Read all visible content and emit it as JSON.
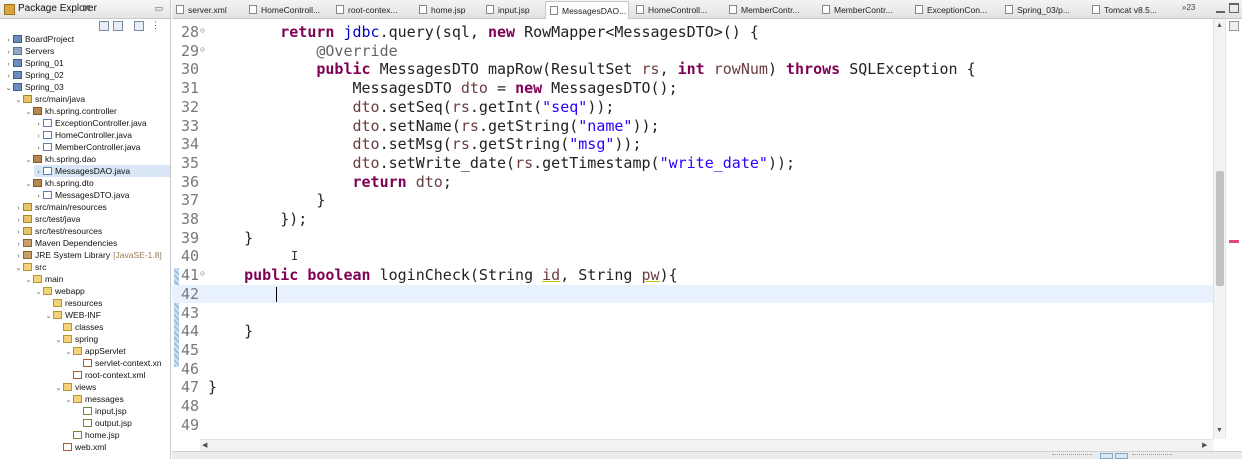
{
  "explorer": {
    "title": "Package Explorer",
    "close": "✕",
    "tree": [
      {
        "label": "BoardProject",
        "icon": "project",
        "twisty": "›",
        "depth": 0
      },
      {
        "label": "Servers",
        "icon": "server",
        "twisty": "›",
        "depth": 0
      },
      {
        "label": "Spring_01",
        "icon": "project",
        "twisty": "›",
        "depth": 0
      },
      {
        "label": "Spring_02",
        "icon": "project",
        "twisty": "›",
        "depth": 0
      },
      {
        "label": "Spring_03",
        "icon": "project",
        "twisty": "⌄",
        "depth": 0
      },
      {
        "label": "src/main/java",
        "icon": "srcfolder",
        "twisty": "⌄",
        "depth": 1
      },
      {
        "label": "kh.spring.controller",
        "icon": "package",
        "twisty": "⌄",
        "depth": 2
      },
      {
        "label": "ExceptionController.java",
        "icon": "java",
        "twisty": "›",
        "depth": 3
      },
      {
        "label": "HomeController.java",
        "icon": "java",
        "twisty": "›",
        "depth": 3
      },
      {
        "label": "MemberController.java",
        "icon": "java",
        "twisty": "›",
        "depth": 3
      },
      {
        "label": "kh.spring.dao",
        "icon": "package",
        "twisty": "⌄",
        "depth": 2
      },
      {
        "label": "MessagesDAO.java",
        "icon": "java",
        "twisty": "›",
        "depth": 3,
        "selected": true
      },
      {
        "label": "kh.spring.dto",
        "icon": "package",
        "twisty": "⌄",
        "depth": 2
      },
      {
        "label": "MessagesDTO.java",
        "icon": "java",
        "twisty": "›",
        "depth": 3
      },
      {
        "label": "src/main/resources",
        "icon": "srcfolder",
        "twisty": "›",
        "depth": 1
      },
      {
        "label": "src/test/java",
        "icon": "srcfolder",
        "twisty": "›",
        "depth": 1
      },
      {
        "label": "src/test/resources",
        "icon": "srcfolder",
        "twisty": "›",
        "depth": 1
      },
      {
        "label": "Maven Dependencies",
        "icon": "lib",
        "twisty": "›",
        "depth": 1
      },
      {
        "label": "JRE System Library",
        "suffix": "[JavaSE-1.8]",
        "icon": "lib",
        "twisty": "›",
        "depth": 1
      },
      {
        "label": "src",
        "icon": "folder",
        "twisty": "⌄",
        "depth": 1
      },
      {
        "label": "main",
        "icon": "folder",
        "twisty": "⌄",
        "depth": 2
      },
      {
        "label": "webapp",
        "icon": "folder",
        "twisty": "⌄",
        "depth": 3
      },
      {
        "label": "resources",
        "icon": "folder",
        "twisty": "",
        "depth": 4
      },
      {
        "label": "WEB-INF",
        "icon": "folder",
        "twisty": "⌄",
        "depth": 4
      },
      {
        "label": "classes",
        "icon": "folder",
        "twisty": "",
        "depth": 5
      },
      {
        "label": "spring",
        "icon": "folder",
        "twisty": "⌄",
        "depth": 5
      },
      {
        "label": "appServlet",
        "icon": "folder",
        "twisty": "⌄",
        "depth": 6
      },
      {
        "label": "servlet-context.xn",
        "icon": "xml",
        "twisty": "",
        "depth": 7
      },
      {
        "label": "root-context.xml",
        "icon": "xml",
        "twisty": "",
        "depth": 6
      },
      {
        "label": "views",
        "icon": "folder",
        "twisty": "⌄",
        "depth": 5
      },
      {
        "label": "messages",
        "icon": "folder",
        "twisty": "⌄",
        "depth": 6
      },
      {
        "label": "input.jsp",
        "icon": "jsp",
        "twisty": "",
        "depth": 7
      },
      {
        "label": "output.jsp",
        "icon": "jsp",
        "twisty": "",
        "depth": 7
      },
      {
        "label": "home.jsp",
        "icon": "jsp",
        "twisty": "",
        "depth": 6
      },
      {
        "label": "web.xml",
        "icon": "xml",
        "twisty": "",
        "depth": 5
      }
    ]
  },
  "tabs": [
    {
      "label": "server.xml",
      "icon": "xml-icon",
      "close": ""
    },
    {
      "label": "HomeControll...",
      "icon": "java-icon",
      "close": ""
    },
    {
      "label": "root-contex...",
      "icon": "xml-icon",
      "close": ""
    },
    {
      "label": "home.jsp",
      "icon": "jsp-icon",
      "close": ""
    },
    {
      "label": "input.jsp",
      "icon": "jsp-icon",
      "close": ""
    },
    {
      "label": "MessagesDAO...",
      "icon": "java-icon",
      "close": "✕",
      "active": true
    },
    {
      "label": "HomeControll...",
      "icon": "java-icon",
      "close": ""
    },
    {
      "label": "MemberContr...",
      "icon": "java-icon",
      "close": ""
    },
    {
      "label": "MemberContr...",
      "icon": "java-icon",
      "close": ""
    },
    {
      "label": "ExceptionCon...",
      "icon": "java-icon",
      "close": ""
    },
    {
      "label": "Spring_03/p...",
      "icon": "xml-icon",
      "close": ""
    },
    {
      "label": "Tomcat v8.5...",
      "icon": "server-icon",
      "close": ""
    }
  ],
  "tab_overflow": "»23",
  "editor": {
    "lines": [
      {
        "n": "28",
        "fold": "⊖",
        "tokens": [
          [
            "",
            "        "
          ],
          [
            "kw",
            "return"
          ],
          [
            "",
            " "
          ],
          [
            "fld",
            "jdbc"
          ],
          [
            "",
            ".query(sql, "
          ],
          [
            "kw",
            "new"
          ],
          [
            "",
            " RowMapper<MessagesDTO>() {"
          ]
        ]
      },
      {
        "n": "29",
        "fold": "⊖",
        "tokens": [
          [
            "",
            "            "
          ],
          [
            "ann",
            "@Override"
          ]
        ]
      },
      {
        "n": "30",
        "fold": "",
        "tokens": [
          [
            "",
            "            "
          ],
          [
            "kw",
            "public"
          ],
          [
            "",
            " MessagesDTO mapRow(ResultSet "
          ],
          [
            "loc",
            "rs"
          ],
          [
            "",
            ", "
          ],
          [
            "kw",
            "int"
          ],
          [
            "",
            " "
          ],
          [
            "loc",
            "rowNum"
          ],
          [
            "",
            ") "
          ],
          [
            "kw",
            "throws"
          ],
          [
            "",
            " SQLException {"
          ]
        ]
      },
      {
        "n": "31",
        "fold": "",
        "tokens": [
          [
            "",
            "                MessagesDTO "
          ],
          [
            "loc",
            "dto"
          ],
          [
            "",
            " = "
          ],
          [
            "kw",
            "new"
          ],
          [
            "",
            " MessagesDTO();"
          ]
        ]
      },
      {
        "n": "32",
        "fold": "",
        "tokens": [
          [
            "",
            "                "
          ],
          [
            "loc",
            "dto"
          ],
          [
            "",
            ".setSeq("
          ],
          [
            "loc",
            "rs"
          ],
          [
            "",
            ".getInt("
          ],
          [
            "str",
            "\"seq\""
          ],
          [
            "",
            "));"
          ]
        ]
      },
      {
        "n": "33",
        "fold": "",
        "tokens": [
          [
            "",
            "                "
          ],
          [
            "loc",
            "dto"
          ],
          [
            "",
            ".setName("
          ],
          [
            "loc",
            "rs"
          ],
          [
            "",
            ".getString("
          ],
          [
            "str",
            "\"name\""
          ],
          [
            "",
            "));"
          ]
        ]
      },
      {
        "n": "34",
        "fold": "",
        "tokens": [
          [
            "",
            "                "
          ],
          [
            "loc",
            "dto"
          ],
          [
            "",
            ".setMsg("
          ],
          [
            "loc",
            "rs"
          ],
          [
            "",
            ".getString("
          ],
          [
            "str",
            "\"msg\""
          ],
          [
            "",
            "));"
          ]
        ]
      },
      {
        "n": "35",
        "fold": "",
        "tokens": [
          [
            "",
            "                "
          ],
          [
            "loc",
            "dto"
          ],
          [
            "",
            ".setWrite_date("
          ],
          [
            "loc",
            "rs"
          ],
          [
            "",
            ".getTimestamp("
          ],
          [
            "str",
            "\"write_date\""
          ],
          [
            "",
            "));"
          ]
        ]
      },
      {
        "n": "36",
        "fold": "",
        "tokens": [
          [
            "",
            "                "
          ],
          [
            "kw",
            "return"
          ],
          [
            "",
            " "
          ],
          [
            "loc",
            "dto"
          ],
          [
            "",
            ";"
          ]
        ]
      },
      {
        "n": "37",
        "fold": "",
        "tokens": [
          [
            "",
            "            }"
          ]
        ]
      },
      {
        "n": "38",
        "fold": "",
        "tokens": [
          [
            "",
            "        });"
          ]
        ]
      },
      {
        "n": "39",
        "fold": "",
        "tokens": [
          [
            "",
            "    }"
          ]
        ]
      },
      {
        "n": "40",
        "fold": "",
        "tokens": [
          [
            "",
            ""
          ]
        ]
      },
      {
        "n": "41",
        "fold": "⊖",
        "tokens": [
          [
            "",
            "    "
          ],
          [
            "kw",
            "public"
          ],
          [
            "",
            " "
          ],
          [
            "kw",
            "boolean"
          ],
          [
            "",
            " loginCheck(String "
          ],
          [
            "locul",
            "id"
          ],
          [
            "",
            ", String "
          ],
          [
            "locul",
            "pw"
          ],
          [
            "",
            "){"
          ]
        ]
      },
      {
        "n": "42",
        "fold": "",
        "current": true,
        "tokens": [
          [
            "",
            "        "
          ]
        ]
      },
      {
        "n": "43",
        "fold": "",
        "tokens": [
          [
            "",
            ""
          ]
        ]
      },
      {
        "n": "44",
        "fold": "",
        "tokens": [
          [
            "",
            "    }"
          ]
        ]
      },
      {
        "n": "45",
        "fold": "",
        "tokens": [
          [
            "",
            ""
          ]
        ]
      },
      {
        "n": "46",
        "fold": "",
        "tokens": [
          [
            "",
            ""
          ]
        ]
      },
      {
        "n": "47",
        "fold": "",
        "tokens": [
          [
            "",
            "}"
          ]
        ]
      },
      {
        "n": "48",
        "fold": "",
        "tokens": [
          [
            "",
            ""
          ]
        ]
      },
      {
        "n": "49",
        "fold": "",
        "tokens": [
          [
            "",
            ""
          ]
        ]
      }
    ]
  },
  "colors": {
    "keyword": "#7f0055",
    "string": "#2a00ff",
    "annotation": "#646464",
    "field": "#0000c0",
    "local": "#6a3e3e",
    "current_line": "#e8f2fe"
  }
}
